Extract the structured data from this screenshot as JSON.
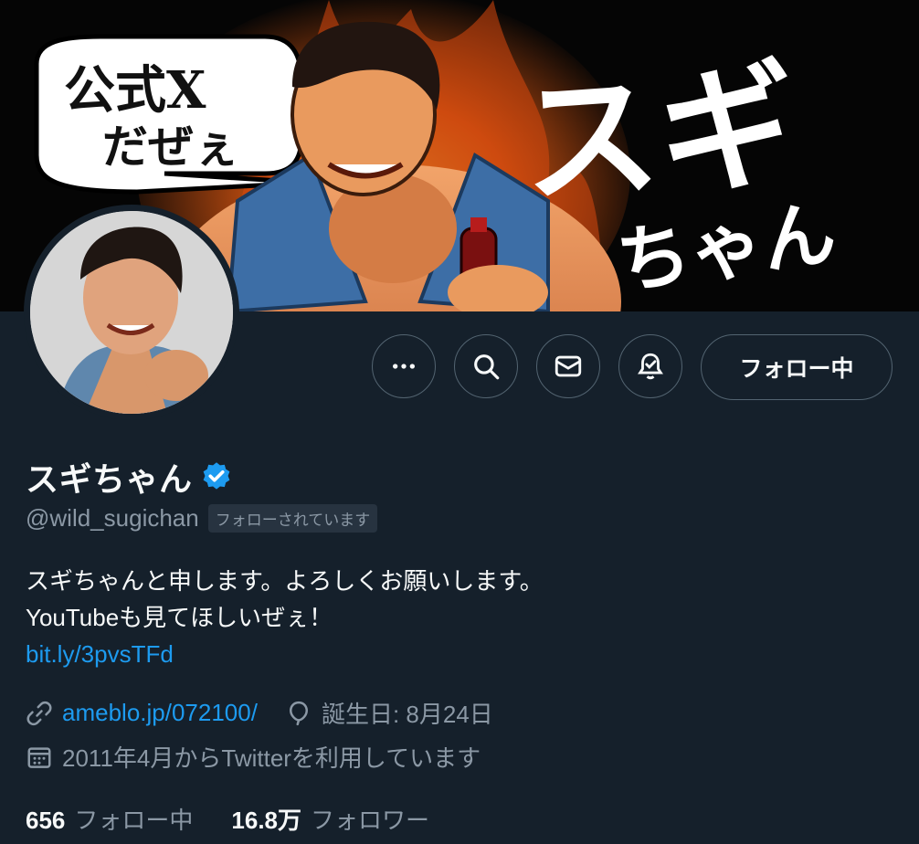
{
  "banner": {
    "bubble_line1": "公式X",
    "bubble_line2": "だぜぇ",
    "title_main": "スギ",
    "title_sub": "ちゃん"
  },
  "actions": {
    "more_icon": "more-horizontal-icon",
    "search_icon": "search-icon",
    "message_icon": "envelope-icon",
    "notify_icon": "bell-check-icon",
    "follow_label": "フォロー中"
  },
  "profile": {
    "name": "スギちゃん",
    "verified_icon": "verified-badge-icon",
    "handle": "@wild_sugichan",
    "follows_you": "フォローされています",
    "bio_line1": "スギちゃんと申します。よろしくお願いします。",
    "bio_line2": "YouTubeも見てほしいぜぇ！",
    "bio_link": "bit.ly/3pvsTFd",
    "website": "ameblo.jp/072100/",
    "birthday": "誕生日: 8月24日",
    "joined": "2011年4月からTwitterを利用しています"
  },
  "stats": {
    "following_count": "656",
    "following_label": "フォロー中",
    "followers_count": "16.8万",
    "followers_label": "フォロワー"
  },
  "colors": {
    "background": "#15202b",
    "link": "#1d9bf0",
    "secondary_text": "#8b98a5",
    "border": "#536471"
  }
}
